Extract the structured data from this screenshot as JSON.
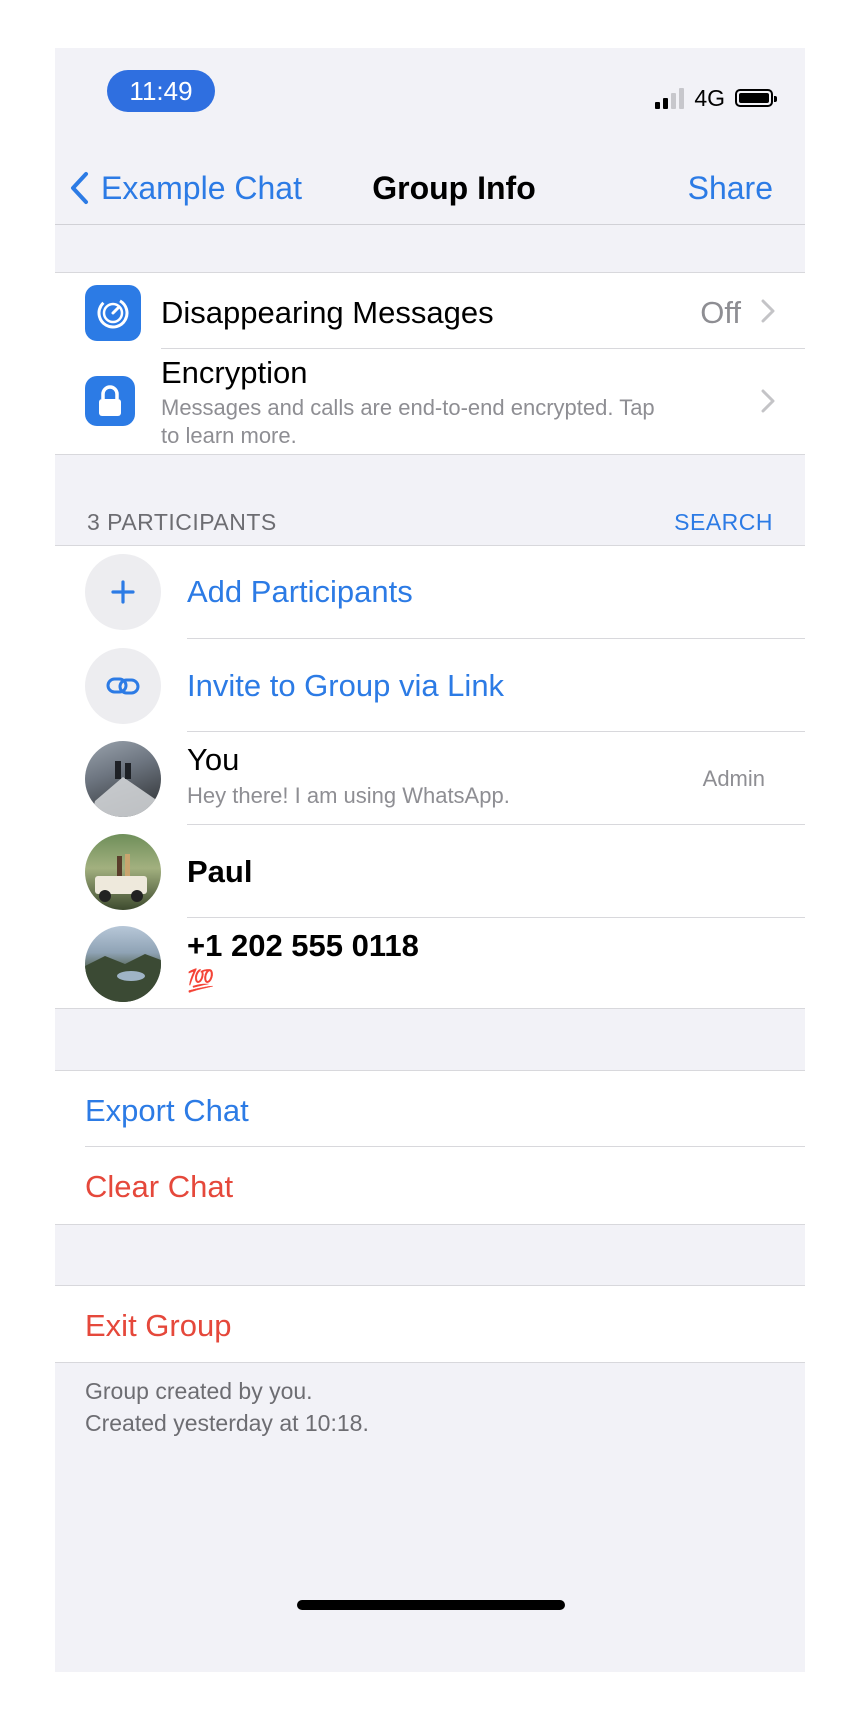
{
  "status_bar": {
    "time": "11:49",
    "network": "4G"
  },
  "nav": {
    "back_label": "Example Chat",
    "title": "Group Info",
    "share_label": "Share"
  },
  "settings": {
    "disappearing": {
      "label": "Disappearing Messages",
      "value": "Off"
    },
    "encryption": {
      "label": "Encryption",
      "description_line1": "Messages and calls are end-to-end encrypted. Tap",
      "description_line2": "to learn more."
    }
  },
  "participants": {
    "header": "3 PARTICIPANTS",
    "search_label": "SEARCH",
    "add_label": "Add Participants",
    "invite_label": "Invite to Group via Link",
    "members": [
      {
        "name": "You",
        "status": "Hey there! I am using WhatsApp.",
        "role": "Admin"
      },
      {
        "name": "Paul"
      },
      {
        "name": "+1 202 555 0118",
        "status": "💯"
      }
    ]
  },
  "actions": {
    "export": "Export Chat",
    "clear": "Clear Chat",
    "exit": "Exit Group"
  },
  "footer": {
    "line1": "Group created by you.",
    "line2": "Created yesterday at 10:18."
  },
  "colors": {
    "accent": "#2c7be5",
    "destructive": "#e5483b",
    "secondary_text": "#8e8e93"
  },
  "icons": [
    "chevron-left-icon",
    "timer-icon",
    "lock-icon",
    "chevron-right-icon",
    "plus-icon",
    "link-icon"
  ]
}
